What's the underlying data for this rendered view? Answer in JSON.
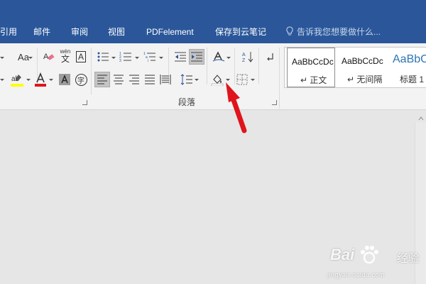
{
  "tabs": [
    {
      "label": "引用"
    },
    {
      "label": "邮件"
    },
    {
      "label": "审阅"
    },
    {
      "label": "视图"
    },
    {
      "label": "PDFelement"
    },
    {
      "label": "保存到云笔记"
    }
  ],
  "tell_me": {
    "placeholder": "告诉我您想要做什么..."
  },
  "ribbon": {
    "font_case_label": "Aa",
    "phonetic_label": "wén",
    "phonetic_glyph": "文",
    "border_char_glyph": "A",
    "enclose_char_glyph": "字",
    "paragraph_group_label": "段落",
    "sort_label": "A Z"
  },
  "styles": [
    {
      "sample": "AaBbCcDc",
      "name": "↵ 正文",
      "selected": true
    },
    {
      "sample": "AaBbCcDc",
      "name": "↵ 无间隔",
      "selected": false
    },
    {
      "sample": "AaBbC",
      "name": "标题 1",
      "selected": false
    }
  ],
  "watermark": {
    "brand": "Bai",
    "brand_tail": "经验",
    "url": "jingyan.baidu.com"
  },
  "colors": {
    "title_bar": "#2b579a",
    "ribbon_bg": "#f3f3f3",
    "doc_bg": "#e6e6e6",
    "arrow": "#e0141c",
    "heading_style": "#2e74b5"
  },
  "icons": [
    "font-case-icon",
    "eraser-icon",
    "phonetic-guide-icon",
    "character-border-icon",
    "bullets-icon",
    "numbering-icon",
    "multilevel-list-icon",
    "decrease-indent-icon",
    "increase-indent-icon",
    "chinese-layout-icon",
    "sort-icon",
    "show-marks-icon",
    "highlight-icon",
    "font-color-icon",
    "character-shading-icon",
    "enclose-characters-icon",
    "align-left-icon",
    "align-center-icon",
    "align-right-icon",
    "justify-icon",
    "distributed-icon",
    "line-spacing-icon",
    "shading-icon",
    "borders-icon",
    "lightbulb-icon"
  ]
}
